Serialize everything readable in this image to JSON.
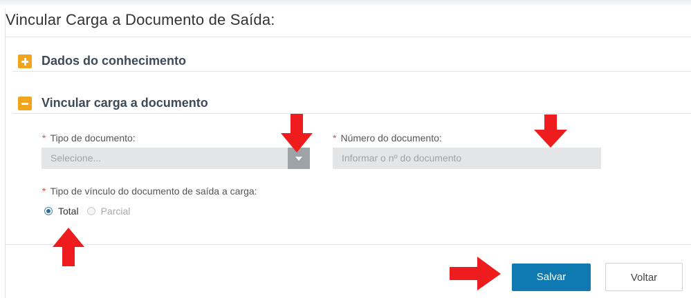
{
  "page": {
    "title": "Vincular Carga a Documento de Saída:"
  },
  "sections": [
    {
      "title": "Dados do conhecimento",
      "icon": "plus-icon",
      "state": "collapsed"
    },
    {
      "title": "Vincular carga a documento",
      "icon": "minus-icon",
      "state": "expanded"
    }
  ],
  "form": {
    "required_mark": "*",
    "tipo_documento": {
      "label": "Tipo de documento:",
      "value": "Selecione..."
    },
    "numero_documento": {
      "label": "Número do documento:",
      "placeholder": "Informar o nº do documento"
    },
    "tipo_vinculo": {
      "label": "Tipo de vínculo do documento de saída a carga:",
      "options": [
        {
          "label": "Total",
          "selected": true
        },
        {
          "label": "Parcial",
          "selected": false,
          "disabled": true
        }
      ]
    }
  },
  "actions": {
    "save_label": "Salvar",
    "back_label": "Voltar"
  },
  "annotations": {
    "arrow_color": "#ee1c1c",
    "arrows": [
      "down-arrow",
      "down-arrow",
      "up-arrow",
      "right-arrow"
    ]
  },
  "colors": {
    "section_icon": "#f0a51d",
    "primary_button": "#0f7ab1",
    "required": "#e04b4b"
  }
}
